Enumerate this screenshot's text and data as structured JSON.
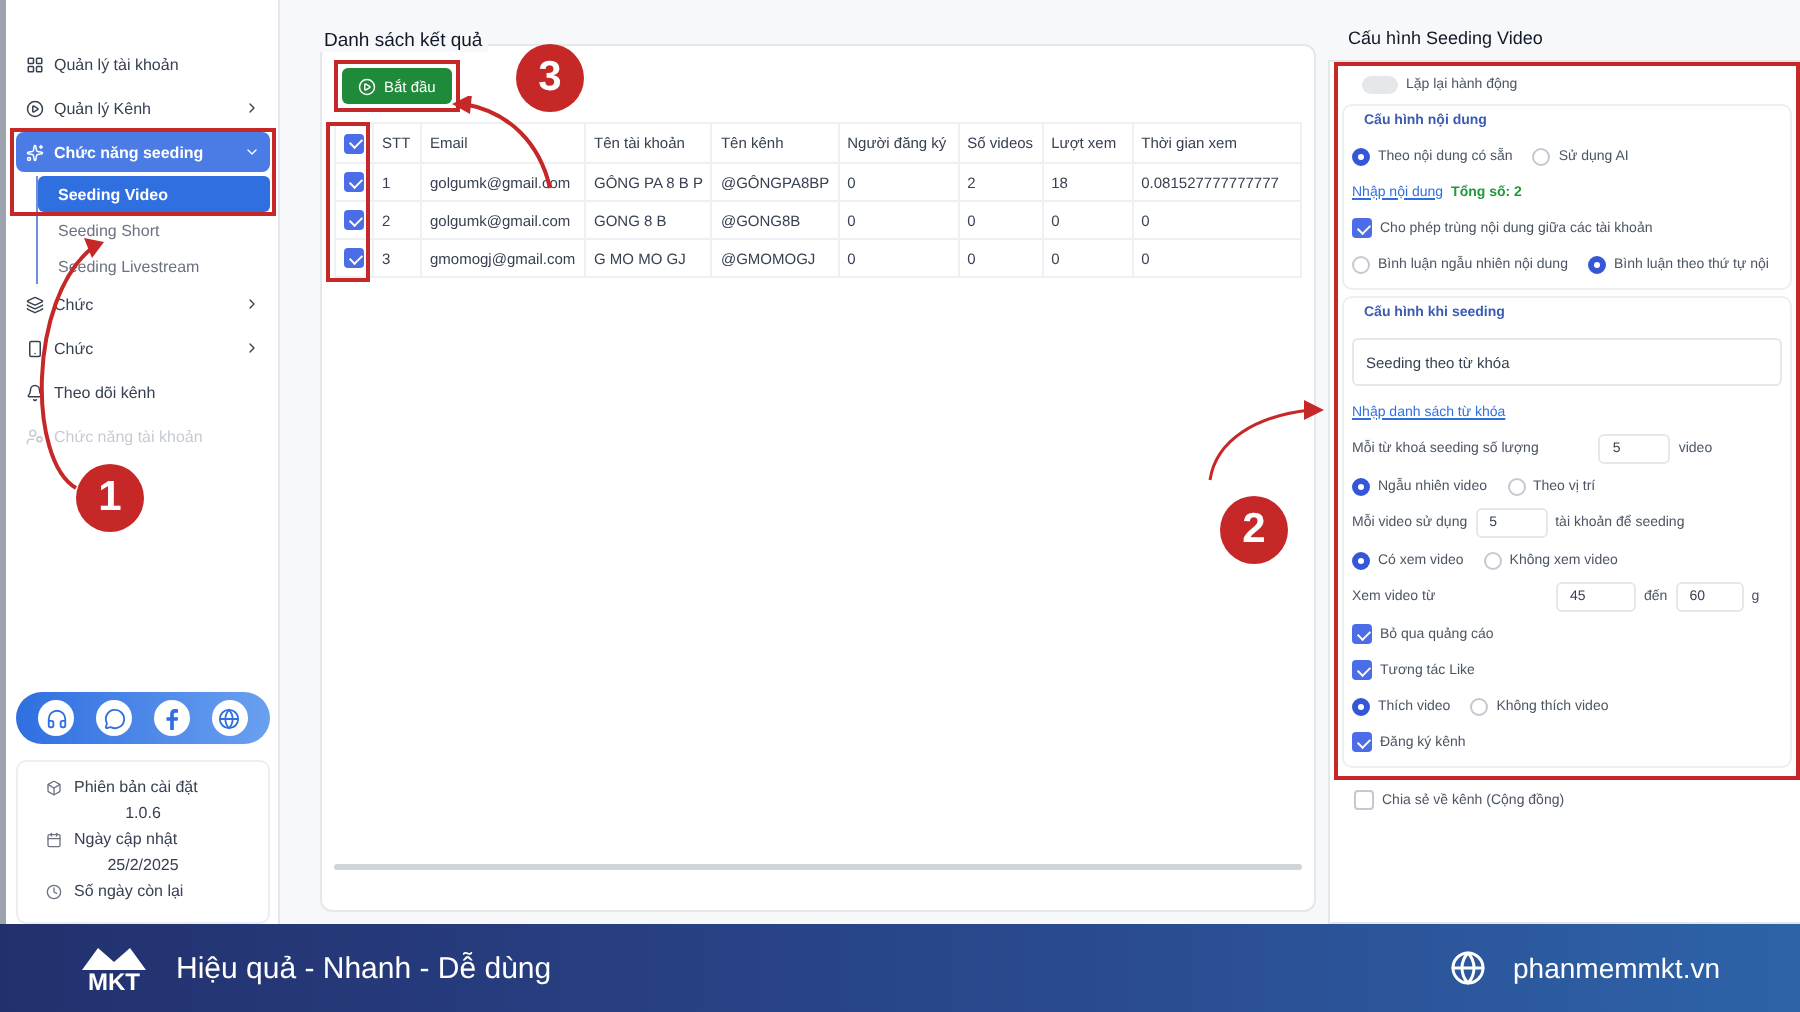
{
  "sidebar": {
    "items": [
      {
        "label": "Quản lý tài khoản",
        "kind": "link",
        "selected": false,
        "disabled": false
      },
      {
        "label": "Quản lý Kênh",
        "kind": "group",
        "expanded": false,
        "selected": false,
        "disabled": false
      },
      {
        "label": "Chức năng seeding",
        "kind": "group",
        "expanded": true,
        "selected": true,
        "disabled": false,
        "children": [
          {
            "label": "Seeding Video",
            "selected": true
          },
          {
            "label": "Seeding Short",
            "selected": false
          },
          {
            "label": "Seeding Livestream",
            "selected": false
          }
        ]
      },
      {
        "label": "Chức",
        "kind": "group",
        "expanded": false,
        "selected": false,
        "disabled": false
      },
      {
        "label": "Chức",
        "kind": "group",
        "expanded": false,
        "selected": false,
        "disabled": false
      },
      {
        "label": "Theo dõi kênh",
        "kind": "link",
        "selected": false,
        "disabled": false
      },
      {
        "label": "Chức năng tài khoản",
        "kind": "link",
        "selected": false,
        "disabled": true
      }
    ],
    "info": [
      {
        "label": "Phiên bản cài đặt",
        "value": "1.0.6"
      },
      {
        "label": "Ngày cập nhật",
        "value": "25/2/2025"
      },
      {
        "label": "Số ngày còn lại"
      }
    ]
  },
  "results": {
    "title": "Danh sách kết quả",
    "start_button": "Bắt đầu",
    "columns": [
      "STT",
      "Email",
      "Tên tài khoản",
      "Tên kênh",
      "Người đăng ký",
      "Số videos",
      "Lượt xem",
      "Thời gian xem"
    ],
    "header_checked": true,
    "rows": [
      {
        "checked": true,
        "cells": [
          "1",
          "golgumk@gmail.com",
          "GÔNG PA 8 B P",
          "@GÔNGPA8BP",
          "0",
          "2",
          "18",
          "0.081527777777777"
        ]
      },
      {
        "checked": true,
        "cells": [
          "2",
          "golgumk@gmail.com",
          "GONG 8 B",
          "@GONG8B",
          "0",
          "0",
          "0",
          "0"
        ]
      },
      {
        "checked": true,
        "cells": [
          "3",
          "gmomogj@gmail.com",
          "G MO MO GJ",
          "@GMOMOGJ",
          "0",
          "0",
          "0",
          "0"
        ]
      }
    ]
  },
  "config": {
    "title": "Cấu hình Seeding Video",
    "repeat": {
      "label": "Lặp lại hành động",
      "on": false
    },
    "content": {
      "legend": "Cấu hình nội dung",
      "source_options": [
        {
          "label": "Theo nội dung có sẵn",
          "selected": true
        },
        {
          "label": "Sử dụng AI",
          "selected": false
        }
      ],
      "input_link": "Nhập nội dung",
      "total": "Tổng số: 2",
      "allow_duplicate": {
        "label": "Cho phép trùng nội dung giữa các tài khoản",
        "checked": true
      },
      "order_options": [
        {
          "label": "Bình luận ngẫu nhiên nội dung",
          "selected": false
        },
        {
          "label": "Bình luận theo thứ tự nội",
          "selected": true
        }
      ]
    },
    "seeding": {
      "legend": "Cấu hình khi seeding",
      "mode": "Seeding theo từ khóa",
      "keyword_link": "Nhập danh sách từ khóa",
      "rows": [
        {
          "kind": "number",
          "label": "Mỗi từ khoá seeding số lượng",
          "value": "5",
          "unit": "video"
        },
        {
          "kind": "radios",
          "options": [
            {
              "label": "Ngẫu nhiên video",
              "selected": true
            },
            {
              "label": "Theo vị trí",
              "selected": false
            }
          ]
        },
        {
          "kind": "number",
          "label": "Mỗi video sử dụng",
          "value": "5",
          "unit": "tài khoản để seeding"
        },
        {
          "kind": "radios",
          "options": [
            {
              "label": "Có xem video",
              "selected": true
            },
            {
              "label": "Không xem video",
              "selected": false
            }
          ]
        },
        {
          "kind": "range",
          "label": "Xem video từ",
          "from": "45",
          "to_label": "đến",
          "to": "60",
          "unit": "g"
        },
        {
          "kind": "checkbox",
          "label": "Bỏ qua quảng cáo",
          "checked": true
        },
        {
          "kind": "checkbox",
          "label": "Tương tác Like",
          "checked": true
        },
        {
          "kind": "radios",
          "options": [
            {
              "label": "Thích video",
              "selected": true
            },
            {
              "label": "Không thích video",
              "selected": false
            }
          ]
        },
        {
          "kind": "checkbox",
          "label": "Đăng ký kênh",
          "checked": true
        }
      ]
    },
    "share": {
      "label": "Chia sẻ về kênh (Cộng đồng)",
      "checked": false
    }
  },
  "annotations": [
    {
      "label": "1"
    },
    {
      "label": "2"
    },
    {
      "label": "3"
    }
  ],
  "footer": {
    "logo": "MKT",
    "slogan": "Hiệu quả - Nhanh - Dễ dùng",
    "website": "phanmemmkt.vn"
  }
}
